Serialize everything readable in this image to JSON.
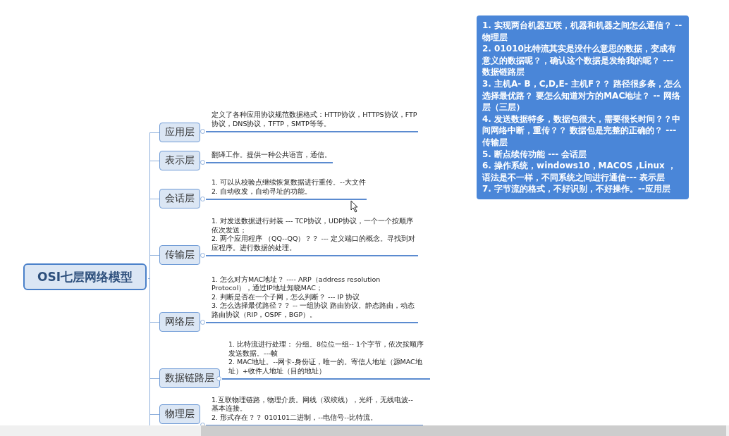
{
  "root": {
    "title": "OSI七层网络模型"
  },
  "layers": [
    {
      "name": "应用层",
      "notes": [
        "定义了各种应用协议规范数据格式：HTTP协议，HTTPS协议，FTP协议，DNS协议，TFTP，SMTP等等。"
      ]
    },
    {
      "name": "表示层",
      "notes": [
        "翻译工作。提供一种公共语言，通信。"
      ]
    },
    {
      "name": "会话层",
      "notes": [
        "1. 可以从校验点继续恢复数据进行重传。--大文件",
        "2. 自动收发，自动寻址的功能。"
      ]
    },
    {
      "name": "传输层",
      "notes": [
        "1. 对发送数据进行封装 --- TCP协议，UDP协议，一个一个按顺序依次发送；",
        "2. 两个应用程序 （QQ--QQ）？？ --- 定义端口的概念。寻找到对应程序。进行数据的处理。"
      ]
    },
    {
      "name": "网络层",
      "notes": [
        "1. 怎么对方MAC地址？ ---- ARP（address resolution Protocol），通过IP地址知晓MAC；",
        "2. 判断是否在一个子网，怎么判断？ ---  IP 协议",
        "3. 怎么选择最优路径？？ -- 一组协议 路由协议。静态路由，动态路由协议（RIP，OSPF，BGP）。"
      ]
    },
    {
      "name": "数据链路层",
      "notes": [
        "1. 比特流进行处理： 分组。8位位一组-- 1个字节，依次按顺序发送数据。---帧",
        "2.  MAC地址。--网卡-身份证，唯一的。寄信人地址（源MAC地址）+收件人地址（目的地址）"
      ]
    },
    {
      "name": "物理层",
      "notes": [
        "1.互联物理链路，物理介质。网线（双绞线），光纤，无线电波--基本连接。",
        "2. 形式存在？？ 010101二进制，--电信号--比特流。"
      ]
    }
  ],
  "note_box": {
    "lines": [
      "1. 实现两台机器互联，机器和机器之间怎么通信？ --物理层",
      "2. 01010比特流其实是没什么意思的数据，变成有意义的数据呢？，确认这个数据是发给我的呢？ --- 数据链路层",
      "3. 主机A- B，C,D,E- 主机F？？ 路径很多条，怎么选择最优路？ 要怎么知道对方的MAC地址？ -- 网络层（三层）",
      "4. 发送数据特多，数据包很大，需要很长时间？？中间网络中断，重传？？ 数据包是完整的正确的？ ---传输层",
      "5. 断点续传功能 --- 会话层",
      "6. 操作系统，windows10，MACOS ,Linux ，语法是不一样，不同系统之间进行通信--- 表示层",
      "7. 字节流的格式，不好识别，不好操作。--应用层"
    ]
  }
}
